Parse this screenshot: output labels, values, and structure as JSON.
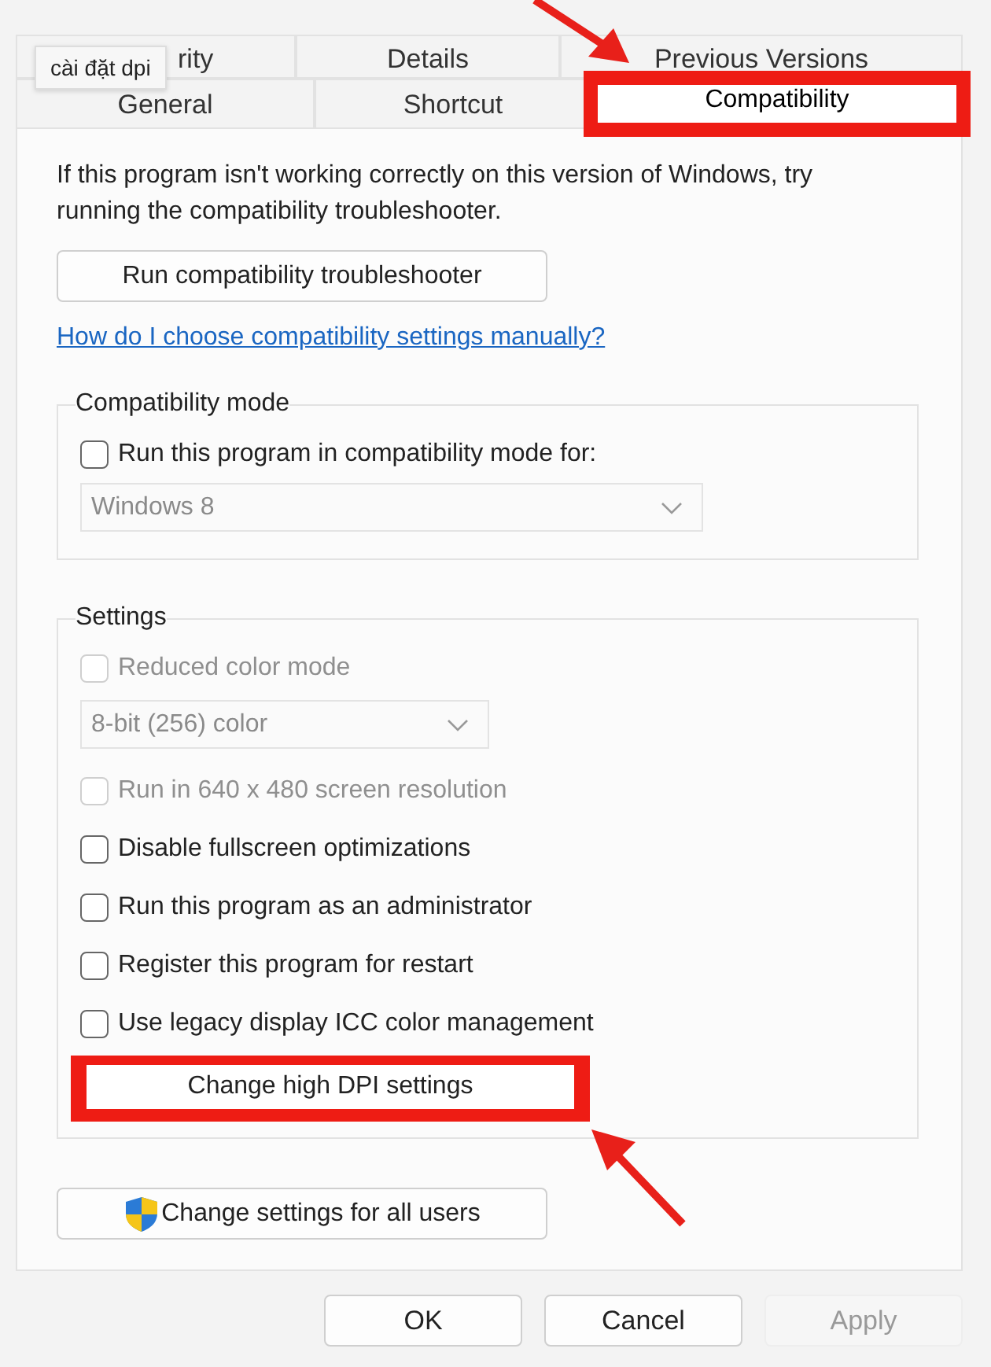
{
  "tooltip": "cài đặt dpi",
  "tabs_row_1": [
    {
      "label": "rity",
      "selected": false
    },
    {
      "label": "Details",
      "selected": false
    },
    {
      "label": "Previous Versions",
      "selected": false
    }
  ],
  "tabs_row_2": [
    {
      "label": "General",
      "selected": false
    },
    {
      "label": "Shortcut",
      "selected": false
    },
    {
      "label": "Compatibility",
      "selected": true,
      "highlighted": true
    }
  ],
  "intro": "If this program isn't working correctly on this version of Windows, try running the compatibility troubleshooter.",
  "troubleshooter_button": "Run compatibility troubleshooter",
  "help_link": "How do I choose compatibility settings manually?",
  "compatibility_mode": {
    "title": "Compatibility mode",
    "option": {
      "label": "Run this program in compatibility mode for:",
      "checked": false,
      "disabled": false
    },
    "dropdown": {
      "value": "Windows 8",
      "disabled": true
    }
  },
  "settings": {
    "title": "Settings",
    "items": [
      {
        "kind": "checkbox",
        "label": "Reduced color mode",
        "checked": false,
        "disabled": true
      },
      {
        "kind": "dropdown",
        "value": "8-bit (256) color",
        "disabled": true
      },
      {
        "kind": "checkbox",
        "label": "Run in 640 x 480 screen resolution",
        "checked": false,
        "disabled": true
      },
      {
        "kind": "checkbox",
        "label": "Disable fullscreen optimizations",
        "checked": false,
        "disabled": false
      },
      {
        "kind": "checkbox",
        "label": "Run this program as an administrator",
        "checked": false,
        "disabled": false
      },
      {
        "kind": "checkbox",
        "label": "Register this program for restart",
        "checked": false,
        "disabled": false
      },
      {
        "kind": "checkbox",
        "label": "Use legacy display ICC color management",
        "checked": false,
        "disabled": false
      },
      {
        "kind": "button",
        "label": "Change high DPI settings",
        "highlighted": true
      }
    ]
  },
  "all_users_button": "Change settings for all users",
  "buttons": [
    {
      "label": "OK",
      "disabled": false
    },
    {
      "label": "Cancel",
      "disabled": false
    },
    {
      "label": "Apply",
      "disabled": true
    }
  ]
}
